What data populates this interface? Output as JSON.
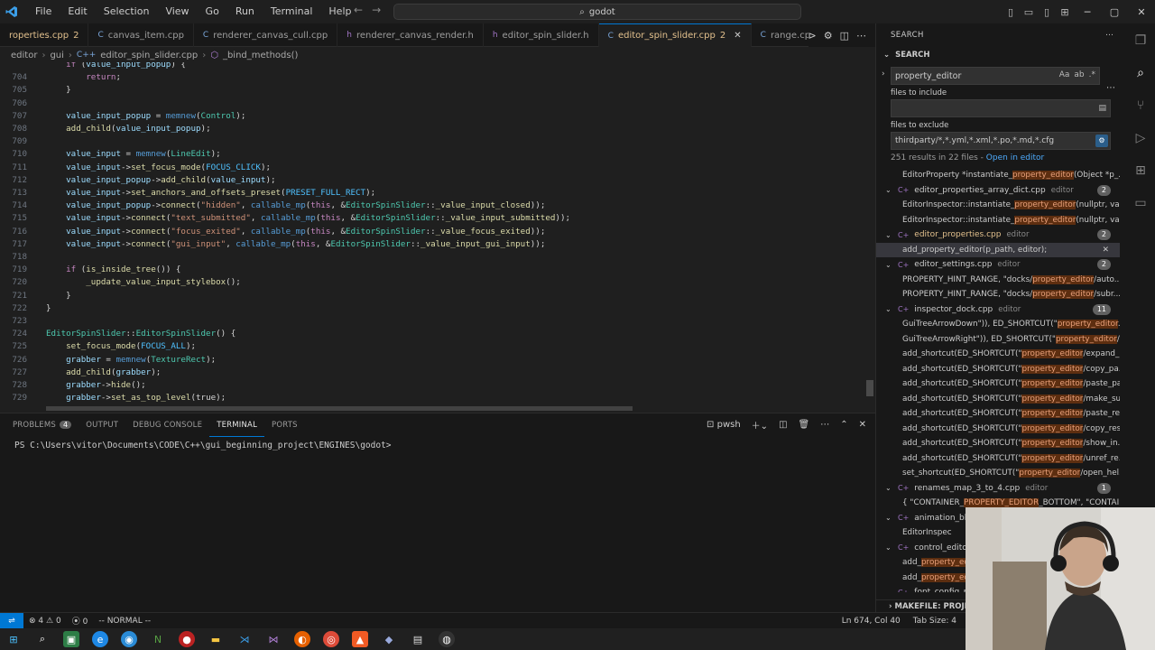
{
  "titlebar": {
    "menu": [
      "File",
      "Edit",
      "Selection",
      "View",
      "Go",
      "Run",
      "Terminal",
      "Help"
    ],
    "command_center": "godot"
  },
  "editor_tabs": [
    {
      "label": "roperties.cpp",
      "badge": "2",
      "state": "modified"
    },
    {
      "label": "canvas_item.cpp",
      "badge": "",
      "state": "normal"
    },
    {
      "label": "renderer_canvas_cull.cpp",
      "badge": "",
      "state": "normal"
    },
    {
      "label": "renderer_canvas_render.h",
      "badge": "",
      "state": "normal"
    },
    {
      "label": "editor_spin_slider.h",
      "badge": "",
      "state": "normal"
    },
    {
      "label": "editor_spin_slider.cpp",
      "badge": "2",
      "state": "active"
    },
    {
      "label": "range.cpp",
      "badge": "",
      "state": "normal"
    }
  ],
  "breadcrumb": [
    "editor",
    "gui",
    "editor_spin_slider.cpp",
    "_bind_methods()"
  ],
  "code": {
    "lines": [
      {
        "n": "",
        "t": "\tif (value_input_popup) {"
      },
      {
        "n": "704",
        "t": "\t\treturn;"
      },
      {
        "n": "705",
        "t": "\t}"
      },
      {
        "n": "706",
        "t": ""
      },
      {
        "n": "707",
        "t": "\tvalue_input_popup = memnew(Control);"
      },
      {
        "n": "708",
        "t": "\tadd_child(value_input_popup);"
      },
      {
        "n": "709",
        "t": ""
      },
      {
        "n": "710",
        "t": "\tvalue_input = memnew(LineEdit);"
      },
      {
        "n": "711",
        "t": "\tvalue_input->set_focus_mode(FOCUS_CLICK);"
      },
      {
        "n": "712",
        "t": "\tvalue_input_popup->add_child(value_input);"
      },
      {
        "n": "713",
        "t": "\tvalue_input->set_anchors_and_offsets_preset(PRESET_FULL_RECT);"
      },
      {
        "n": "714",
        "t": "\tvalue_input_popup->connect(\"hidden\", callable_mp(this, &EditorSpinSlider::_value_input_closed));"
      },
      {
        "n": "715",
        "t": "\tvalue_input->connect(\"text_submitted\", callable_mp(this, &EditorSpinSlider::_value_input_submitted));"
      },
      {
        "n": "716",
        "t": "\tvalue_input->connect(\"focus_exited\", callable_mp(this, &EditorSpinSlider::_value_focus_exited));"
      },
      {
        "n": "717",
        "t": "\tvalue_input->connect(\"gui_input\", callable_mp(this, &EditorSpinSlider::_value_input_gui_input));"
      },
      {
        "n": "718",
        "t": ""
      },
      {
        "n": "719",
        "t": "\tif (is_inside_tree()) {"
      },
      {
        "n": "720",
        "t": "\t\t_update_value_input_stylebox();"
      },
      {
        "n": "721",
        "t": "\t}"
      },
      {
        "n": "722",
        "t": "}"
      },
      {
        "n": "723",
        "t": ""
      },
      {
        "n": "724",
        "t": "EditorSpinSlider::EditorSpinSlider() {"
      },
      {
        "n": "725",
        "t": "\tset_focus_mode(FOCUS_ALL);"
      },
      {
        "n": "726",
        "t": "\tgrabber = memnew(TextureRect);"
      },
      {
        "n": "727",
        "t": "\tadd_child(grabber);"
      },
      {
        "n": "728",
        "t": "\tgrabber->hide();"
      },
      {
        "n": "729",
        "t": "\tgrabber->set_as_top_level(true);"
      }
    ]
  },
  "panel": {
    "tabs": [
      {
        "label": "PROBLEMS",
        "count": "4"
      },
      {
        "label": "OUTPUT",
        "count": ""
      },
      {
        "label": "DEBUG CONSOLE",
        "count": ""
      },
      {
        "label": "TERMINAL",
        "count": ""
      },
      {
        "label": "PORTS",
        "count": ""
      }
    ],
    "active_tab": "TERMINAL",
    "shell": "pwsh",
    "terminal_prompt": "PS C:\\Users\\vitor\\Documents\\CODE\\C++\\gui_beginning_project\\ENGINES\\godot>"
  },
  "sidebar": {
    "header": "SEARCH",
    "section": "SEARCH",
    "query": "property_editor",
    "search_options": [
      "Aa",
      "ab",
      ".*"
    ],
    "files_to_include_label": "files to include",
    "files_to_include_value": "",
    "files_to_exclude_label": "files to exclude",
    "files_to_exclude_value": "thirdparty/*,*.yml,*.xml,*.po,*.md,*.cfg",
    "summary": "251 results in 22 files - ",
    "open_in_editor": "Open in editor",
    "results": [
      {
        "kind": "match",
        "pre": "EditorProperty *instantiate_",
        "hl": "property_editor",
        "post": "(Object *p_..."
      },
      {
        "kind": "file",
        "name": "editor_properties_array_dict.cpp",
        "dir": "editor",
        "count": "2",
        "modified": false
      },
      {
        "kind": "match",
        "pre": "EditorInspector::instantiate_",
        "hl": "property_editor",
        "post": "(nullptr, val..."
      },
      {
        "kind": "match",
        "pre": "EditorInspector::instantiate_",
        "hl": "property_editor",
        "post": "(nullptr, val..."
      },
      {
        "kind": "file",
        "name": "editor_properties.cpp",
        "dir": "editor",
        "count": "2",
        "modified": true
      },
      {
        "kind": "match",
        "pre": "add_property_editor(p_path, editor);",
        "hl": "",
        "post": "",
        "selected": true
      },
      {
        "kind": "file",
        "name": "editor_settings.cpp",
        "dir": "editor",
        "count": "2",
        "modified": false
      },
      {
        "kind": "match",
        "pre": "PROPERTY_HINT_RANGE, \"docks/",
        "hl": "property_editor",
        "post": "/auto..."
      },
      {
        "kind": "match",
        "pre": "PROPERTY_HINT_RANGE, \"docks/",
        "hl": "property_editor",
        "post": "/subr..."
      },
      {
        "kind": "file",
        "name": "inspector_dock.cpp",
        "dir": "editor",
        "count": "11",
        "modified": false
      },
      {
        "kind": "match",
        "pre": "GuiTreeArrowDown\")), ED_SHORTCUT(\"",
        "hl": "property_editor",
        "post": "..."
      },
      {
        "kind": "match",
        "pre": "GuiTreeArrowRight\")), ED_SHORTCUT(\"",
        "hl": "property_editor",
        "post": "/..."
      },
      {
        "kind": "match",
        "pre": "add_shortcut(ED_SHORTCUT(\"",
        "hl": "property_editor",
        "post": "/expand_..."
      },
      {
        "kind": "match",
        "pre": "add_shortcut(ED_SHORTCUT(\"",
        "hl": "property_editor",
        "post": "/copy_pa..."
      },
      {
        "kind": "match",
        "pre": "add_shortcut(ED_SHORTCUT(\"",
        "hl": "property_editor",
        "post": "/paste_pa..."
      },
      {
        "kind": "match",
        "pre": "add_shortcut(ED_SHORTCUT(\"",
        "hl": "property_editor",
        "post": "/make_su..."
      },
      {
        "kind": "match",
        "pre": "add_shortcut(ED_SHORTCUT(\"",
        "hl": "property_editor",
        "post": "/paste_re..."
      },
      {
        "kind": "match",
        "pre": "add_shortcut(ED_SHORTCUT(\"",
        "hl": "property_editor",
        "post": "/copy_res..."
      },
      {
        "kind": "match",
        "pre": "add_shortcut(ED_SHORTCUT(\"",
        "hl": "property_editor",
        "post": "/show_in..."
      },
      {
        "kind": "match",
        "pre": "add_shortcut(ED_SHORTCUT(\"",
        "hl": "property_editor",
        "post": "/unref_re..."
      },
      {
        "kind": "match",
        "pre": "set_shortcut(ED_SHORTCUT(\"",
        "hl": "property_editor",
        "post": "/open_hel..."
      },
      {
        "kind": "file",
        "name": "renames_map_3_to_4.cpp",
        "dir": "editor",
        "count": "1",
        "modified": false
      },
      {
        "kind": "match",
        "pre": "{ \"CONTAINER_",
        "hl": "PROPERTY_EDITOR",
        "post": "_BOTTOM\", \"CONTAI..."
      },
      {
        "kind": "file",
        "name": "animation_ble",
        "dir": "",
        "count": "",
        "modified": false
      },
      {
        "kind": "match",
        "pre": "EditorInspec",
        "hl": "",
        "post": ""
      },
      {
        "kind": "file",
        "name": "control_editor",
        "dir": "",
        "count": "",
        "modified": false
      },
      {
        "kind": "match",
        "pre": "add_",
        "hl": "property_ed",
        "post": ""
      },
      {
        "kind": "match",
        "pre": "add_",
        "hl": "property_ed",
        "post": ""
      },
      {
        "kind": "file",
        "name": "font_config_p",
        "dir": "",
        "count": "",
        "modified": false
      }
    ],
    "makefile_section": "MAKEFILE: PROJECT O"
  },
  "statusbar": {
    "errors": "4",
    "warnings": "0",
    "ports": "0",
    "mode": "-- NORMAL --",
    "position": "Ln 674, Col 40",
    "tab_size": "Tab Size: 4"
  },
  "colors": {
    "accent": "#0078d4",
    "editor_bg": "#1f1f1f",
    "sidebar_bg": "#181818",
    "match_highlight": "#ea5c00"
  }
}
